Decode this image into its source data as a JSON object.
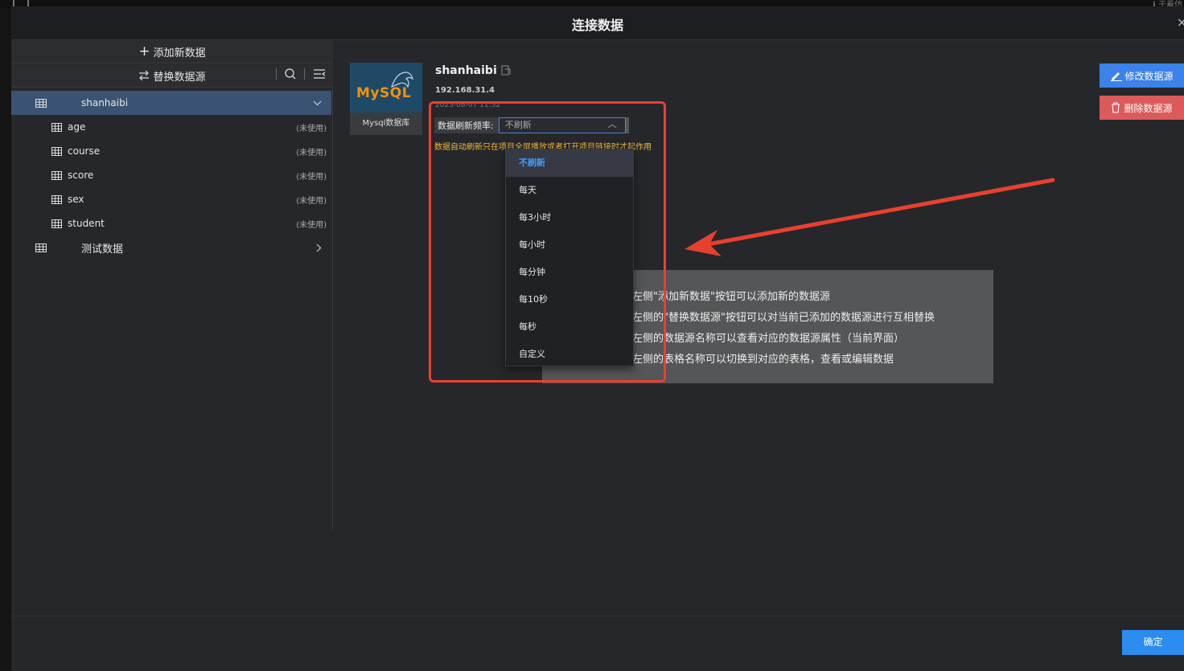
{
  "top_right_text": "ℹ 于着仿",
  "dialog": {
    "title": "连接数据",
    "close": "×"
  },
  "sidebar": {
    "add_label": "添加新数据",
    "switch_label": "替换数据源",
    "datasources": [
      {
        "name": "shanhaibi",
        "expanded": true,
        "tables": [
          {
            "name": "age",
            "status": "(未使用)"
          },
          {
            "name": "course",
            "status": "(未使用)"
          },
          {
            "name": "score",
            "status": "(未使用)"
          },
          {
            "name": "sex",
            "status": "(未使用)"
          },
          {
            "name": "student",
            "status": "(未使用)"
          }
        ]
      },
      {
        "name": "测试数据",
        "expanded": false
      }
    ]
  },
  "datasource_detail": {
    "logo_text": "MySQL",
    "type_caption": "Mysql数据库",
    "name": "shanhaibi",
    "host": "192.168.31.4",
    "date": "2023-08-07 11:32",
    "refresh_label": "数据刷新频率:",
    "refresh_value": "不刷新",
    "refresh_hint": "数据自动刷新只在项目全屏播放或者打开项目链接时才起作用"
  },
  "refresh_options": [
    "不刷新",
    "每天",
    "每3小时",
    "每小时",
    "每分钟",
    "每10秒",
    "每秒",
    "自定义"
  ],
  "tips": [
    "左侧\"添加新数据\"按钮可以添加新的数据源",
    "左侧的\"替换数据源\"按钮可以对当前已添加的数据源进行互相替换",
    "左侧的数据源名称可以查看对应的数据源属性（当前界面）",
    "左侧的表格名称可以切换到对应的表格，查看或编辑数据"
  ],
  "actions": {
    "edit_label": "修改数据源",
    "delete_label": "删除数据源",
    "confirm_label": "确定"
  },
  "colors": {
    "accent": "#3b82e9",
    "danger": "#dd5a5a",
    "highlight": "#e8402f",
    "warning_text": "#f2b93b"
  }
}
